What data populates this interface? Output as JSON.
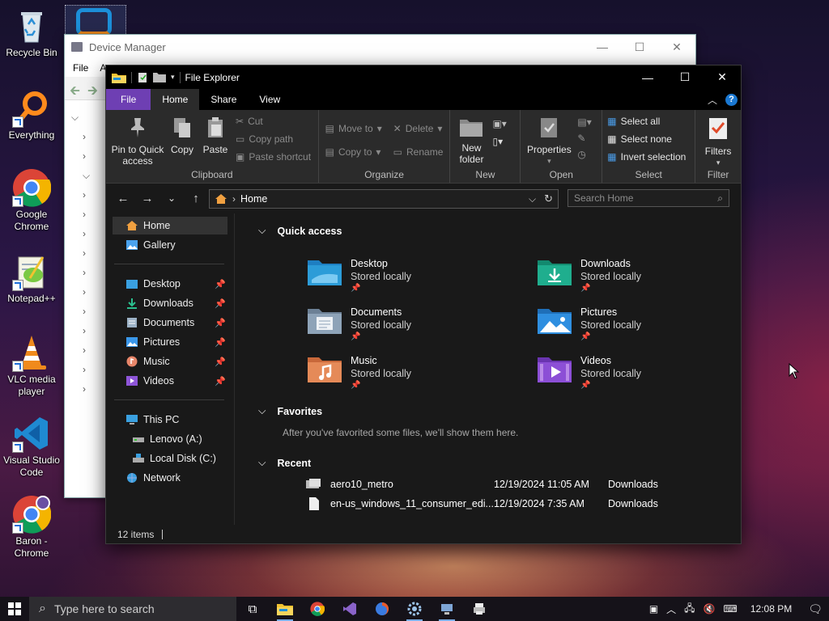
{
  "desktop": {
    "icons": [
      {
        "label": "Recycle Bin"
      },
      {
        "label": "Everything"
      },
      {
        "label": "Google Chrome"
      },
      {
        "label": "Notepad++"
      },
      {
        "label": "VLC media player"
      },
      {
        "label": "Visual Studio Code"
      },
      {
        "label": "Baron - Chrome"
      }
    ]
  },
  "device_manager": {
    "title": "Device Manager",
    "menu": [
      "File",
      "A"
    ]
  },
  "explorer": {
    "title": "File Explorer",
    "tabs": {
      "file": "File",
      "home": "Home",
      "share": "Share",
      "view": "View"
    },
    "ribbon": {
      "clipboard": {
        "label": "Clipboard",
        "pin": "Pin to Quick access",
        "copy": "Copy",
        "paste": "Paste",
        "cut": "Cut",
        "copy_path": "Copy path",
        "paste_shortcut": "Paste shortcut"
      },
      "organize": {
        "label": "Organize",
        "move_to": "Move to",
        "copy_to": "Copy to",
        "delete": "Delete",
        "rename": "Rename"
      },
      "new": {
        "label": "New",
        "new_folder": "New folder"
      },
      "open": {
        "label": "Open",
        "properties": "Properties"
      },
      "select": {
        "label": "Select",
        "select_all": "Select all",
        "select_none": "Select none",
        "invert": "Invert selection"
      },
      "filter": {
        "label": "Filter",
        "filters": "Filters"
      }
    },
    "address": {
      "location": "Home"
    },
    "search": {
      "placeholder": "Search Home"
    },
    "nav": {
      "home": "Home",
      "gallery": "Gallery",
      "pinned": [
        {
          "label": "Desktop"
        },
        {
          "label": "Downloads"
        },
        {
          "label": "Documents"
        },
        {
          "label": "Pictures"
        },
        {
          "label": "Music"
        },
        {
          "label": "Videos"
        }
      ],
      "this_pc": "This PC",
      "drives": [
        {
          "label": "Lenovo (A:)"
        },
        {
          "label": "Local Disk (C:)"
        }
      ],
      "network": "Network"
    },
    "quick_access": {
      "header": "Quick access",
      "items": [
        {
          "name": "Desktop",
          "sub": "Stored locally",
          "color": "#2c9cd8"
        },
        {
          "name": "Downloads",
          "sub": "Stored locally",
          "color": "#1fae8e"
        },
        {
          "name": "Documents",
          "sub": "Stored locally",
          "color": "#8ea3b8"
        },
        {
          "name": "Pictures",
          "sub": "Stored locally",
          "color": "#2f8fe0"
        },
        {
          "name": "Music",
          "sub": "Stored locally",
          "color": "#e58a58"
        },
        {
          "name": "Videos",
          "sub": "Stored locally",
          "color": "#8c4fd6"
        }
      ]
    },
    "favorites": {
      "header": "Favorites",
      "empty_text": "After you've favorited some files, we'll show them here."
    },
    "recent": {
      "header": "Recent",
      "rows": [
        {
          "name": "aero10_metro",
          "date": "12/19/2024 11:05 AM",
          "location": "Downloads"
        },
        {
          "name": "en-us_windows_11_consumer_edi...",
          "date": "12/19/2024 7:35 AM",
          "location": "Downloads"
        }
      ]
    },
    "status": {
      "count": "12 items"
    }
  },
  "taskbar": {
    "search_placeholder": "Type here to search",
    "time": "12:08 PM"
  }
}
